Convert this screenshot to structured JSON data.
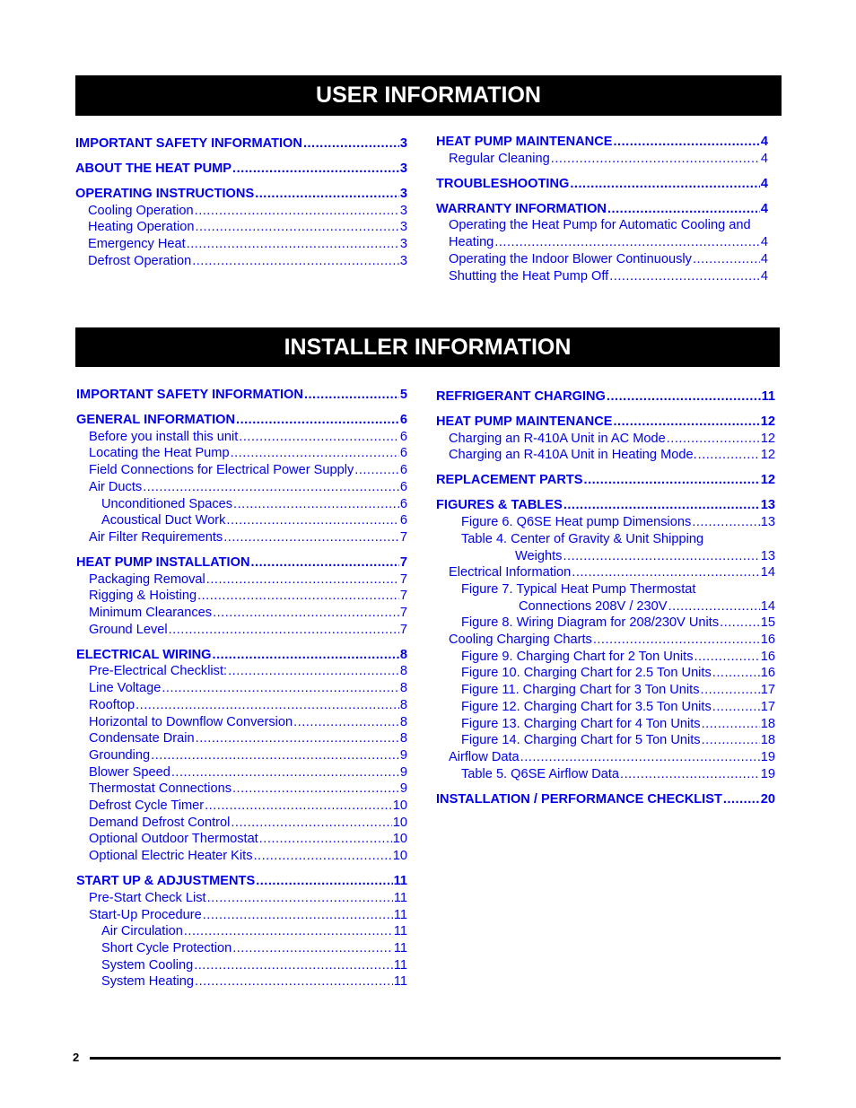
{
  "user_information": {
    "title": "USER INFORMATION",
    "left_column": [
      {
        "level": 0,
        "title": "IMPORTANT SAFETY INFORMATION",
        "page": "3"
      },
      {
        "level": 0,
        "title": "ABOUT THE HEAT PUMP",
        "page": "3"
      },
      {
        "level": 0,
        "title": "OPERATING INSTRUCTIONS",
        "page": "3"
      },
      {
        "level": 1,
        "title": "Cooling Operation",
        "page": "3"
      },
      {
        "level": 1,
        "title": "Heating Operation",
        "page": "3"
      },
      {
        "level": 1,
        "title": "Emergency Heat",
        "page": "3"
      },
      {
        "level": 1,
        "title": "Defrost Operation",
        "page": "3"
      }
    ],
    "right_column": [
      {
        "level": 0,
        "title": "HEAT PUMP MAINTENANCE",
        "page": "4"
      },
      {
        "level": 1,
        "title": "Regular Cleaning",
        "page": "4"
      },
      {
        "level": 0,
        "title": "TROUBLESHOOTING",
        "page": "4"
      },
      {
        "level": 0,
        "title": "WARRANTY INFORMATION",
        "page": "4"
      },
      {
        "level": 1,
        "title": "Operating the Heat Pump for Automatic Cooling and",
        "continuation": "Heating",
        "page": "4"
      },
      {
        "level": 1,
        "title": "Operating the Indoor Blower Continuously",
        "page": "4"
      },
      {
        "level": 1,
        "title": "Shutting the Heat Pump Off",
        "page": "4"
      }
    ]
  },
  "installer_information": {
    "title": "INSTALLER INFORMATION",
    "left_column": [
      {
        "level": 0,
        "title": "IMPORTANT SAFETY INFORMATION",
        "page": "5"
      },
      {
        "level": 0,
        "title": "GENERAL INFORMATION",
        "page": "6"
      },
      {
        "level": 1,
        "title": "Before you install this unit",
        "page": "6"
      },
      {
        "level": 1,
        "title": "Locating the Heat Pump",
        "page": "6"
      },
      {
        "level": 1,
        "title": "Field Connections for Electrical Power Supply",
        "page": "6"
      },
      {
        "level": 1,
        "title": "Air Ducts",
        "page": "6"
      },
      {
        "level": 2,
        "title": "Unconditioned Spaces",
        "page": "6"
      },
      {
        "level": 2,
        "title": "Acoustical Duct Work",
        "page": "6"
      },
      {
        "level": 1,
        "title": "Air Filter Requirements",
        "page": "7"
      },
      {
        "level": 0,
        "title": "HEAT PUMP INSTALLATION",
        "page": "7"
      },
      {
        "level": 1,
        "title": "Packaging Removal",
        "page": "7"
      },
      {
        "level": 1,
        "title": "Rigging & Hoisting",
        "page": "7"
      },
      {
        "level": 1,
        "title": "Minimum Clearances",
        "page": "7"
      },
      {
        "level": 1,
        "title": "Ground Level",
        "page": "7"
      },
      {
        "level": 0,
        "title": "ELECTRICAL WIRING",
        "page": "8"
      },
      {
        "level": 1,
        "title": "Pre-Electrical Checklist:",
        "page": "8"
      },
      {
        "level": 1,
        "title": "Line Voltage",
        "page": "8"
      },
      {
        "level": 1,
        "title": "Rooftop",
        "page": "8"
      },
      {
        "level": 1,
        "title": "Horizontal to Downflow Conversion",
        "page": "8"
      },
      {
        "level": 1,
        "title": "Condensate Drain",
        "page": "8"
      },
      {
        "level": 1,
        "title": "Grounding",
        "page": "9"
      },
      {
        "level": 1,
        "title": "Blower Speed",
        "page": "9"
      },
      {
        "level": 1,
        "title": "Thermostat Connections",
        "page": "9"
      },
      {
        "level": 1,
        "title": "Defrost Cycle Timer",
        "page": "10"
      },
      {
        "level": 1,
        "title": "Demand Defrost Control",
        "page": "10"
      },
      {
        "level": 1,
        "title": "Optional Outdoor Thermostat",
        "page": "10"
      },
      {
        "level": 1,
        "title": "Optional Electric Heater Kits",
        "page": "10"
      },
      {
        "level": 0,
        "title": "START UP & ADJUSTMENTS",
        "page": "11"
      },
      {
        "level": 1,
        "title": "Pre-Start Check List",
        "page": "11"
      },
      {
        "level": 1,
        "title": "Start-Up Procedure",
        "page": "11"
      },
      {
        "level": 2,
        "title": "Air Circulation",
        "page": "11"
      },
      {
        "level": 2,
        "title": "Short Cycle Protection",
        "page": "11"
      },
      {
        "level": 2,
        "title": "System Cooling",
        "page": "11"
      },
      {
        "level": 2,
        "title": "System Heating",
        "page": "11"
      }
    ],
    "right_column": [
      {
        "level": 0,
        "title": "REFRIGERANT CHARGING",
        "page": "11"
      },
      {
        "level": 0,
        "title": "HEAT PUMP MAINTENANCE",
        "page": "12"
      },
      {
        "level": 1,
        "title": "Charging an R-410A Unit in AC Mode",
        "page": "12"
      },
      {
        "level": 1,
        "title": "Charging an R-410A Unit in Heating Mode.",
        "page": "12"
      },
      {
        "level": 0,
        "title": "REPLACEMENT PARTS",
        "page": "12"
      },
      {
        "level": 0,
        "title": "FIGURES & TABLES",
        "page": "13"
      },
      {
        "level": 2,
        "title": "Figure 6. Q6SE Heat pump Dimensions",
        "page": "13"
      },
      {
        "level": 2,
        "title": "Table 4. Center of Gravity & Unit Shipping",
        "continuation": "Weights",
        "continuation_indent": "cont2",
        "page": "13"
      },
      {
        "level": 1,
        "title": "Electrical Information",
        "page": "14"
      },
      {
        "level": 2,
        "title": "Figure 7. Typical Heat Pump Thermostat",
        "continuation": "Connections 208V / 230V",
        "continuation_indent": "cont3",
        "page": "14"
      },
      {
        "level": 2,
        "title": "Figure 8. Wiring Diagram for 208/230V Units",
        "page": "15"
      },
      {
        "level": 1,
        "title": "Cooling Charging Charts",
        "page": "16"
      },
      {
        "level": 2,
        "title": "Figure 9. Charging Chart for 2 Ton Units",
        "page": "16"
      },
      {
        "level": 2,
        "title": "Figure 10. Charging Chart for 2.5 Ton Units",
        "page": "16"
      },
      {
        "level": 2,
        "title": "Figure 11. Charging Chart for 3 Ton Units",
        "page": "17"
      },
      {
        "level": 2,
        "title": "Figure 12. Charging Chart for 3.5 Ton Units",
        "page": "17"
      },
      {
        "level": 2,
        "title": "Figure 13. Charging Chart for 4 Ton Units",
        "page": "18"
      },
      {
        "level": 2,
        "title": "Figure 14. Charging Chart for 5 Ton Units",
        "page": "18"
      },
      {
        "level": 1,
        "title": "Airflow Data",
        "page": "19"
      },
      {
        "level": 2,
        "title": "Table 5. Q6SE Airflow Data",
        "page": "19"
      },
      {
        "level": 0,
        "title": "INSTALLATION / PERFORMANCE CHECKLIST",
        "page": "20"
      }
    ]
  },
  "footer": {
    "page_number": "2"
  },
  "colors": {
    "link": "#0000ee",
    "banner_background": "#000000",
    "banner_text": "#ffffff"
  }
}
